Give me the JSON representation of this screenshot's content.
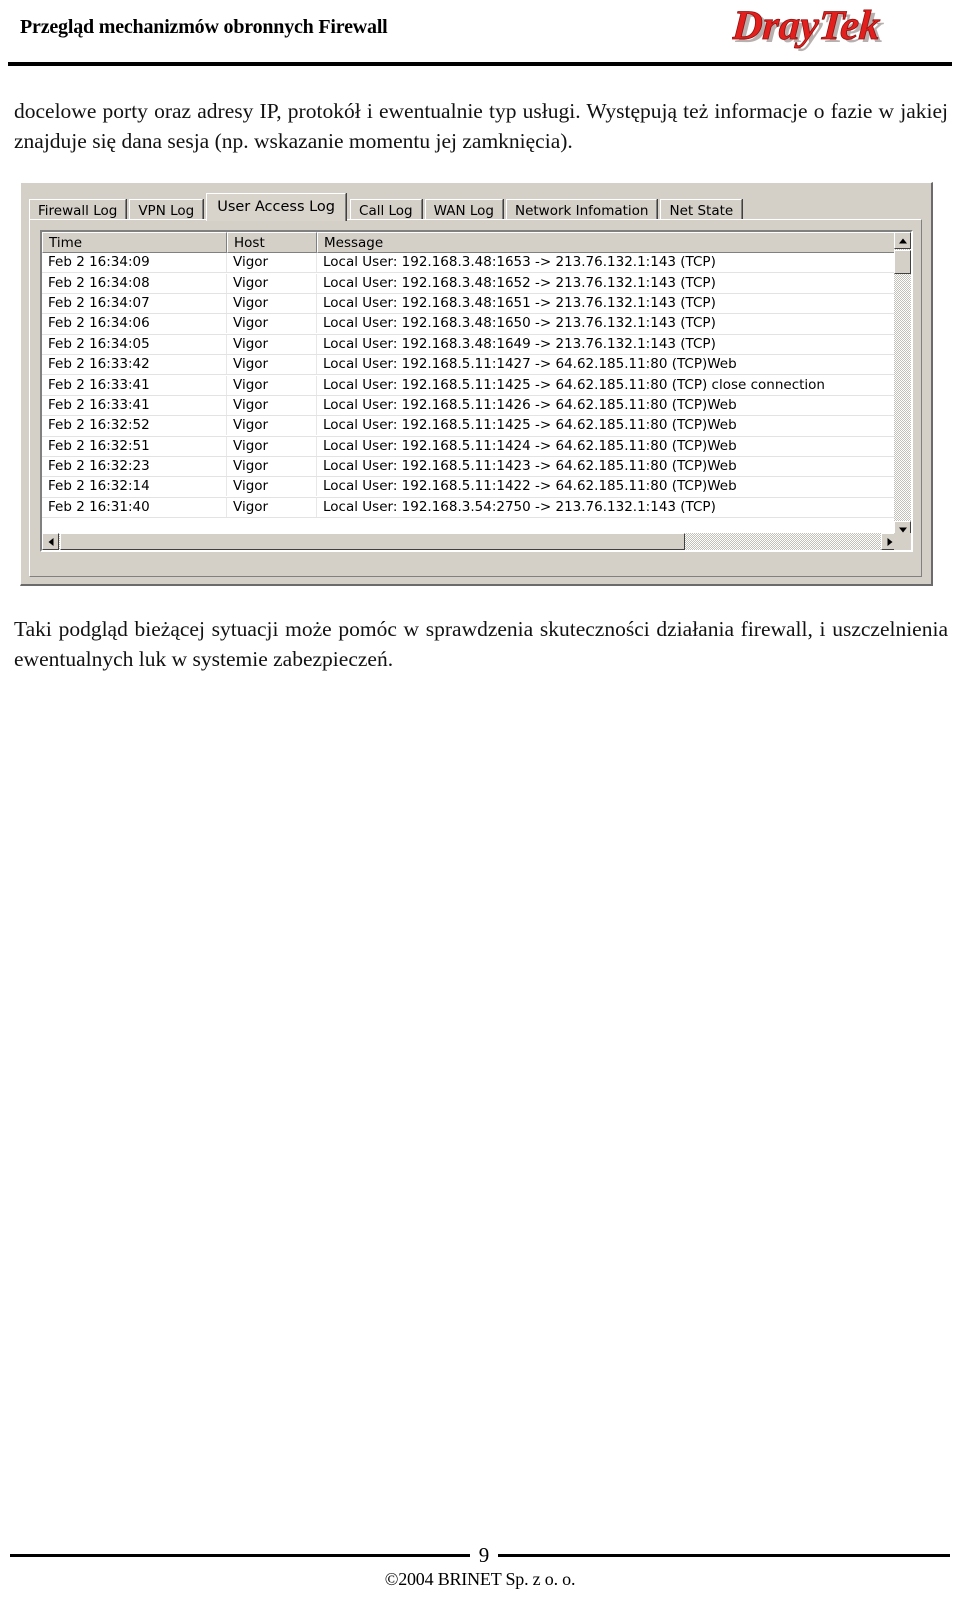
{
  "header": {
    "title": "Przegląd mechanizmów obronnych Firewall",
    "logo_text": "DrayTek",
    "logo_color": "#e2201d"
  },
  "paragraphs": {
    "top": "docelowe porty oraz adresy IP, protokół i ewentualnie typ usługi. Występują też informacje o fazie w jakiej znajduje się dana sesja (np. wskazanie momentu jej zamknięcia).",
    "bottom": "Taki podgląd bieżącej sytuacji może pomóc w sprawdzenia skuteczności działania firewall, i uszczelnienia ewentualnych luk w systemie zabezpieczeń."
  },
  "screenshot": {
    "tabs": [
      {
        "label": "Firewall Log",
        "active": false
      },
      {
        "label": "VPN Log",
        "active": false
      },
      {
        "label": "User Access Log",
        "active": true
      },
      {
        "label": "Call Log",
        "active": false
      },
      {
        "label": "WAN Log",
        "active": false
      },
      {
        "label": "Network Infomation",
        "active": false
      },
      {
        "label": "Net State",
        "active": false
      }
    ],
    "table": {
      "columns": [
        "Time",
        "Host",
        "Message"
      ],
      "rows": [
        {
          "time": "Feb  2 16:34:09",
          "host": "Vigor",
          "message": "Local User: 192.168.3.48:1653 -> 213.76.132.1:143 (TCP)"
        },
        {
          "time": "Feb  2 16:34:08",
          "host": "Vigor",
          "message": "Local User: 192.168.3.48:1652 -> 213.76.132.1:143 (TCP)"
        },
        {
          "time": "Feb  2 16:34:07",
          "host": "Vigor",
          "message": "Local User: 192.168.3.48:1651 -> 213.76.132.1:143 (TCP)"
        },
        {
          "time": "Feb  2 16:34:06",
          "host": "Vigor",
          "message": "Local User: 192.168.3.48:1650 -> 213.76.132.1:143 (TCP)"
        },
        {
          "time": "Feb  2 16:34:05",
          "host": "Vigor",
          "message": "Local User: 192.168.3.48:1649 -> 213.76.132.1:143 (TCP)"
        },
        {
          "time": "Feb  2 16:33:42",
          "host": "Vigor",
          "message": "Local User: 192.168.5.11:1427 -> 64.62.185.11:80 (TCP)Web"
        },
        {
          "time": "Feb  2 16:33:41",
          "host": "Vigor",
          "message": "Local User: 192.168.5.11:1425 -> 64.62.185.11:80 (TCP) close connection"
        },
        {
          "time": "Feb  2 16:33:41",
          "host": "Vigor",
          "message": "Local User: 192.168.5.11:1426 -> 64.62.185.11:80 (TCP)Web"
        },
        {
          "time": "Feb  2 16:32:52",
          "host": "Vigor",
          "message": "Local User: 192.168.5.11:1425 -> 64.62.185.11:80 (TCP)Web"
        },
        {
          "time": "Feb  2 16:32:51",
          "host": "Vigor",
          "message": "Local User: 192.168.5.11:1424 -> 64.62.185.11:80 (TCP)Web"
        },
        {
          "time": "Feb  2 16:32:23",
          "host": "Vigor",
          "message": "Local User: 192.168.5.11:1423 -> 64.62.185.11:80 (TCP)Web"
        },
        {
          "time": "Feb  2 16:32:14",
          "host": "Vigor",
          "message": "Local User: 192.168.5.11:1422 -> 64.62.185.11:80 (TCP)Web"
        },
        {
          "time": "Feb  2 16:31:40",
          "host": "Vigor",
          "message": "Local User: 192.168.3.54:2750 -> 213.76.132.1:143 (TCP)"
        }
      ]
    },
    "scrollbars": {
      "vertical_up": "scroll-up-arrow",
      "vertical_down": "scroll-down-arrow",
      "horizontal_left": "scroll-left-arrow",
      "horizontal_right": "scroll-right-arrow"
    }
  },
  "footer": {
    "page_number": "9",
    "copyright": "©2004 BRINET Sp. z  o. o."
  }
}
